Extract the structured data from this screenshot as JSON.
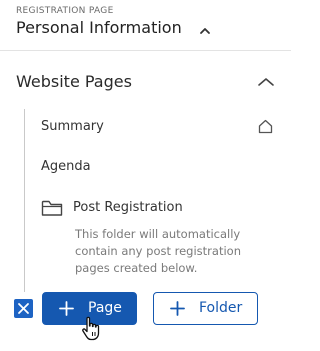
{
  "header": {
    "eyebrow": "REGISTRATION PAGE",
    "title": "Personal Information"
  },
  "section": {
    "title": "Website Pages",
    "items": [
      {
        "label": "Summary",
        "icon": "home-icon"
      },
      {
        "label": "Agenda"
      }
    ],
    "folder": {
      "label": "Post Registration",
      "icon": "folder-icon",
      "note": "This folder will automatically contain any post registration pages created below."
    }
  },
  "actions": {
    "add_page_label": "Page",
    "add_folder_label": "Folder"
  },
  "colors": {
    "primary": "#1558b0",
    "checkbox": "#1d63c3",
    "muted_text": "#7a7a7a"
  }
}
